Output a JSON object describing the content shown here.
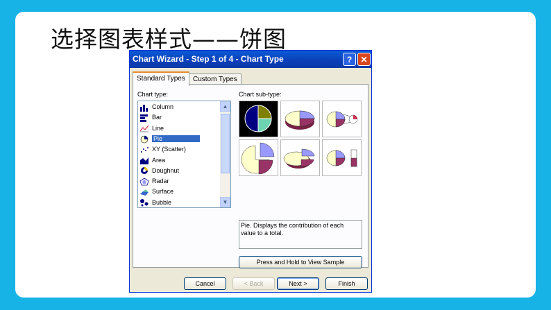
{
  "slide": {
    "title": "选择图表样式——饼图"
  },
  "dialog": {
    "title": "Chart Wizard - Step 1 of 4 - Chart Type",
    "help_label": "?",
    "close_label": "✕",
    "tabs": [
      {
        "label": "Standard Types",
        "active": true
      },
      {
        "label": "Custom Types",
        "active": false
      }
    ],
    "chart_type_label": "Chart type:",
    "chart_subtype_label": "Chart sub-type:",
    "chart_types": [
      {
        "label": "Column",
        "icon": "column-chart-icon",
        "selected": false
      },
      {
        "label": "Bar",
        "icon": "bar-chart-icon",
        "selected": false
      },
      {
        "label": "Line",
        "icon": "line-chart-icon",
        "selected": false
      },
      {
        "label": "Pie",
        "icon": "pie-chart-icon",
        "selected": true
      },
      {
        "label": "XY (Scatter)",
        "icon": "scatter-chart-icon",
        "selected": false
      },
      {
        "label": "Area",
        "icon": "area-chart-icon",
        "selected": false
      },
      {
        "label": "Doughnut",
        "icon": "doughnut-chart-icon",
        "selected": false
      },
      {
        "label": "Radar",
        "icon": "radar-chart-icon",
        "selected": false
      },
      {
        "label": "Surface",
        "icon": "surface-chart-icon",
        "selected": false
      },
      {
        "label": "Bubble",
        "icon": "bubble-chart-icon",
        "selected": false
      }
    ],
    "description": "Pie. Displays the contribution of each value to a total.",
    "sample_button": "Press and Hold to View Sample",
    "buttons": {
      "cancel": "Cancel",
      "back": "< Back",
      "next": "Next >",
      "finish": "Finish"
    },
    "colors": {
      "pie_purple": "#9999ff",
      "pie_maroon": "#993366",
      "pie_cream": "#ffffcc",
      "pie_olive": "#808000",
      "pie_teal": "#6cd4b0",
      "pie_navy": "#000080"
    }
  }
}
